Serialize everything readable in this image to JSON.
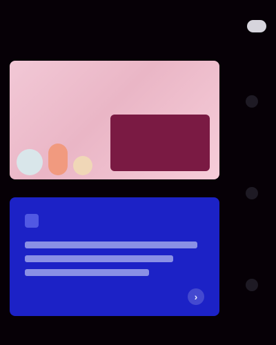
{
  "header": {
    "title": "",
    "action_label": ""
  },
  "cards": [
    {
      "theme": "pink",
      "top_text": "",
      "panel": {
        "title": "",
        "body": ""
      }
    },
    {
      "theme": "blue",
      "title": "",
      "footer_text": "",
      "icon_label": ""
    }
  ],
  "colors": {
    "background": "#060006",
    "pink_card": "#f2c8d6",
    "pink_panel": "#7a1a43",
    "blue_card": "#1c22c6",
    "header_button": "#d6d4dc"
  },
  "icons": {
    "blue_card_icon": "app-icon",
    "blue_card_arrow": "chevron-right-icon"
  }
}
